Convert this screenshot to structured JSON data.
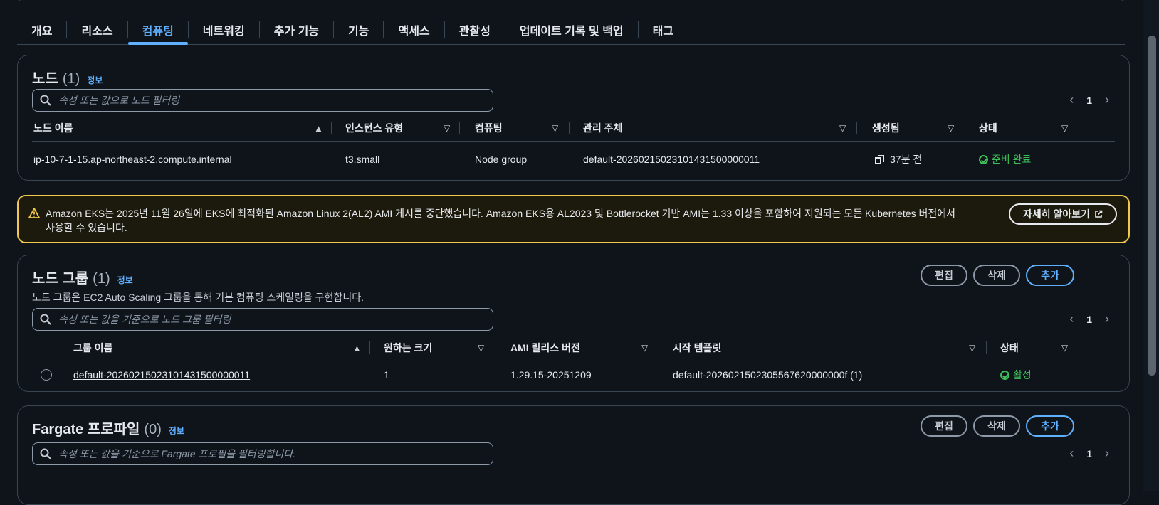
{
  "tabs": [
    "개요",
    "리소스",
    "컴퓨팅",
    "네트워킹",
    "추가 기능",
    "기능",
    "액세스",
    "관찰성",
    "업데이트 기록 및 백업",
    "태그"
  ],
  "active_tab": "컴퓨팅",
  "nodes": {
    "title": "노드",
    "count": "(1)",
    "info": "정보",
    "search_placeholder": "속성 또는 값으로 노드 필터링",
    "page": "1",
    "columns": [
      "노드 이름",
      "인스턴스 유형",
      "컴퓨팅",
      "관리 주체",
      "생성됨",
      "상태"
    ],
    "rows": [
      {
        "name": "ip-10-7-1-15.ap-northeast-2.compute.internal",
        "instance_type": "t3.small",
        "compute": "Node group",
        "managed_by": "default-20260215023101431500000011",
        "created": "37분 전",
        "status": "준비 완료"
      }
    ]
  },
  "alert": {
    "text": "Amazon EKS는 2025년 11월 26일에 EKS에 최적화된 Amazon Linux 2(AL2) AMI 게시를 중단했습니다. Amazon EKS용 AL2023 및 Bottlerocket 기반 AMI는 1.33 이상을 포함하여 지원되는 모든 Kubernetes 버전에서 사용할 수 있습니다.",
    "button": "자세히 알아보기"
  },
  "node_groups": {
    "title": "노드 그룹",
    "count": "(1)",
    "info": "정보",
    "description": "노드 그룹은 EC2 Auto Scaling 그룹을 통해 기본 컴퓨팅 스케일링을 구현합니다.",
    "buttons": {
      "edit": "편집",
      "delete": "삭제",
      "add": "추가"
    },
    "search_placeholder": "속성 또는 값을 기준으로 노드 그룹 필터링",
    "page": "1",
    "columns": [
      "그룹 이름",
      "원하는 크기",
      "AMI 릴리스 버전",
      "시작 템플릿",
      "상태"
    ],
    "rows": [
      {
        "name": "default-20260215023101431500000011",
        "desired_size": "1",
        "ami_version": "1.29.15-20251209",
        "launch_template": "default-2026021502305567620000000f (1)",
        "status": "활성"
      }
    ]
  },
  "fargate": {
    "title": "Fargate 프로파일",
    "count": "(0)",
    "info": "정보",
    "buttons": {
      "edit": "편집",
      "delete": "삭제",
      "add": "추가"
    },
    "search_placeholder": "속성 또는 값을 기준으로 Fargate 프로필을 필터링합니다.",
    "page": "1"
  },
  "colors": {
    "accent": "#5fb0ff",
    "success": "#3fbf5a",
    "warning": "#f2c94c",
    "background": "#0f141a"
  }
}
